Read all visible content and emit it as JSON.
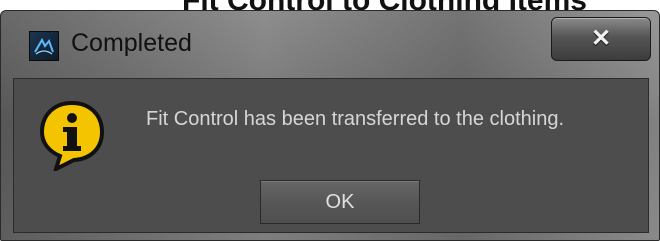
{
  "top_caption": "Fit Control to Clothing Items",
  "dialog": {
    "title": "Completed",
    "close_label": "✕",
    "message": "Fit Control has been transferred to the clothing.",
    "ok_label": "OK",
    "icons": {
      "app": "app-icon",
      "info": "info-icon",
      "close": "close-icon"
    },
    "colors": {
      "client_background": "#4d4d4d",
      "message_text": "#d6d6d6",
      "info_icon_fill": "#f5c400"
    }
  }
}
